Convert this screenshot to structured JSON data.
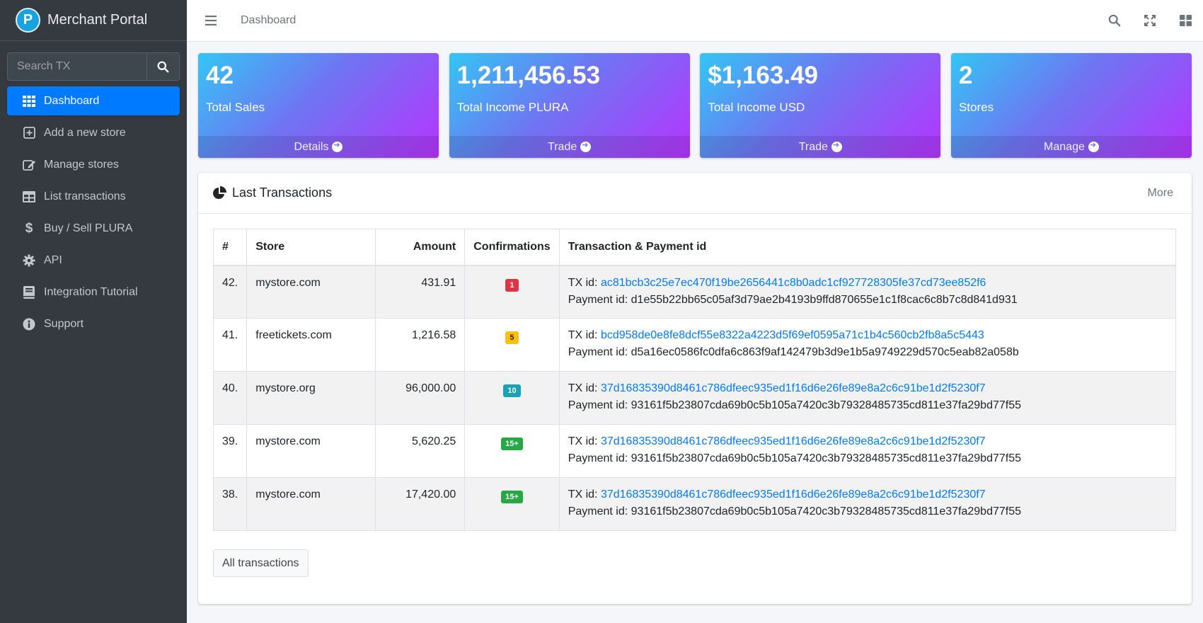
{
  "brand": {
    "name": "Merchant Portal",
    "logo_letter": "P"
  },
  "sidebar": {
    "search_placeholder": "Search TX",
    "items": [
      {
        "label": "Dashboard",
        "icon": "dashboard-grid-icon",
        "active": true
      },
      {
        "label": "Add a new store",
        "icon": "plus-square-icon"
      },
      {
        "label": "Manage stores",
        "icon": "edit-icon"
      },
      {
        "label": "List transactions",
        "icon": "table-icon"
      },
      {
        "label": "Buy / Sell PLURA",
        "icon": "dollar-icon"
      },
      {
        "label": "API",
        "icon": "gear-icon"
      },
      {
        "label": "Integration Tutorial",
        "icon": "book-icon"
      },
      {
        "label": "Support",
        "icon": "info-circle-icon"
      }
    ]
  },
  "header": {
    "title": "Dashboard"
  },
  "cards": [
    {
      "value": "42",
      "label": "Total Sales",
      "action": "Details"
    },
    {
      "value": "1,211,456.53",
      "label": "Total Income PLURA",
      "action": "Trade"
    },
    {
      "value": "$1,163.49",
      "label": "Total Income USD",
      "action": "Trade"
    },
    {
      "value": "2",
      "label": "Stores",
      "action": "Manage"
    }
  ],
  "panel": {
    "title": "Last Transactions",
    "more": "More",
    "columns": [
      "#",
      "Store",
      "Amount",
      "Confirmations",
      "Transaction & Payment id"
    ],
    "tx_prefix": "TX id:",
    "payment_prefix": "Payment id:",
    "rows": [
      {
        "num": "42.",
        "store": "mystore.com",
        "amount": "431.91",
        "conf": "1",
        "conf_color": "#dc3545",
        "tx": "ac81bcb3c25e7ec470f19be2656441c8b0adc1cf927728305fe37cd73ee852f6",
        "payment": "d1e55b22bb65c05af3d79ae2b4193b9ffd870655e1c1f8cac6c8b7c8d841d931"
      },
      {
        "num": "41.",
        "store": "freetickets.com",
        "amount": "1,216.58",
        "conf": "5",
        "conf_color": "#ffc107",
        "tx": "bcd958de0e8fe8dcf55e8322a4223d5f69ef0595a71c1b4c560cb2fb8a5c5443",
        "payment": "d5a16ec0586fc0dfa6c863f9af142479b3d9e1b5a9749229d570c5eab82a058b"
      },
      {
        "num": "40.",
        "store": "mystore.org",
        "amount": "96,000.00",
        "conf": "10",
        "conf_color": "#17a2b8",
        "tx": "37d16835390d8461c786dfeec935ed1f16d6e26fe89e8a2c6c91be1d2f5230f7",
        "payment": "93161f5b23807cda69b0c5b105a7420c3b79328485735cd811e37fa29bd77f55"
      },
      {
        "num": "39.",
        "store": "mystore.com",
        "amount": "5,620.25",
        "conf": "15+",
        "conf_color": "#28a745",
        "tx": "37d16835390d8461c786dfeec935ed1f16d6e26fe89e8a2c6c91be1d2f5230f7",
        "payment": "93161f5b23807cda69b0c5b105a7420c3b79328485735cd811e37fa29bd77f55"
      },
      {
        "num": "38.",
        "store": "mystore.com",
        "amount": "17,420.00",
        "conf": "15+",
        "conf_color": "#28a745",
        "tx": "37d16835390d8461c786dfeec935ed1f16d6e26fe89e8a2c6c91be1d2f5230f7",
        "payment": "93161f5b23807cda69b0c5b105a7420c3b79328485735cd811e37fa29bd77f55"
      }
    ],
    "all_button": "All transactions"
  }
}
